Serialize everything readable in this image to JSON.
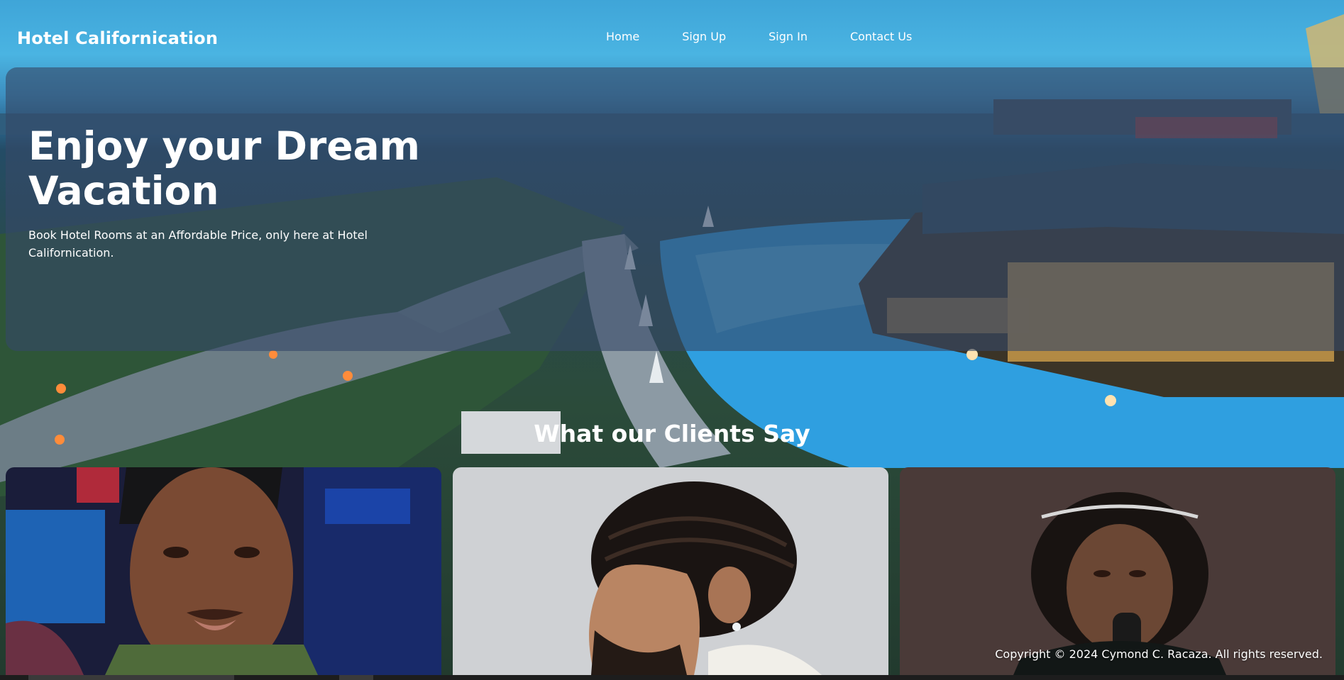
{
  "nav": {
    "brand": "Hotel Californication",
    "links": [
      "Home",
      "Sign Up",
      "Sign In",
      "Contact Us"
    ]
  },
  "hero": {
    "title": "Enjoy your Dream Vacation",
    "subtitle": "Book Hotel Rooms at an Affordable Price, only here at Hotel Californication."
  },
  "clients": {
    "heading": "What our Clients Say"
  },
  "footer": {
    "copyright": "Copyright © 2024 Cymond C. Racaza. All rights reserved."
  },
  "colors": {
    "hero_panel": "#364868",
    "pool": "#2f9fe0",
    "text": "#ffffff"
  }
}
